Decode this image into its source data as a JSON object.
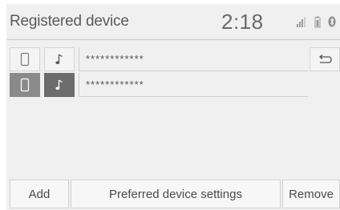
{
  "header": {
    "title": "Registered device",
    "clock": "2:18",
    "status_icons": [
      "signal-icon",
      "battery-icon",
      "bluetooth-icon"
    ]
  },
  "devices": [
    {
      "name": "************",
      "phone_selected": false,
      "audio_selected": false,
      "icons": [
        "phone-icon",
        "music-note-icon"
      ]
    },
    {
      "name": "************",
      "phone_selected": true,
      "audio_selected": true,
      "icons": [
        "phone-icon",
        "music-note-icon"
      ]
    }
  ],
  "back_button": {
    "icon": "back-arrow-icon"
  },
  "buttons": {
    "add": "Add",
    "preferred": "Preferred device settings",
    "remove": "Remove"
  },
  "colors": {
    "screen_bg": "#f0f0f0",
    "selected_phone": "#8a8a8a",
    "selected_audio": "#6c6c6c"
  }
}
